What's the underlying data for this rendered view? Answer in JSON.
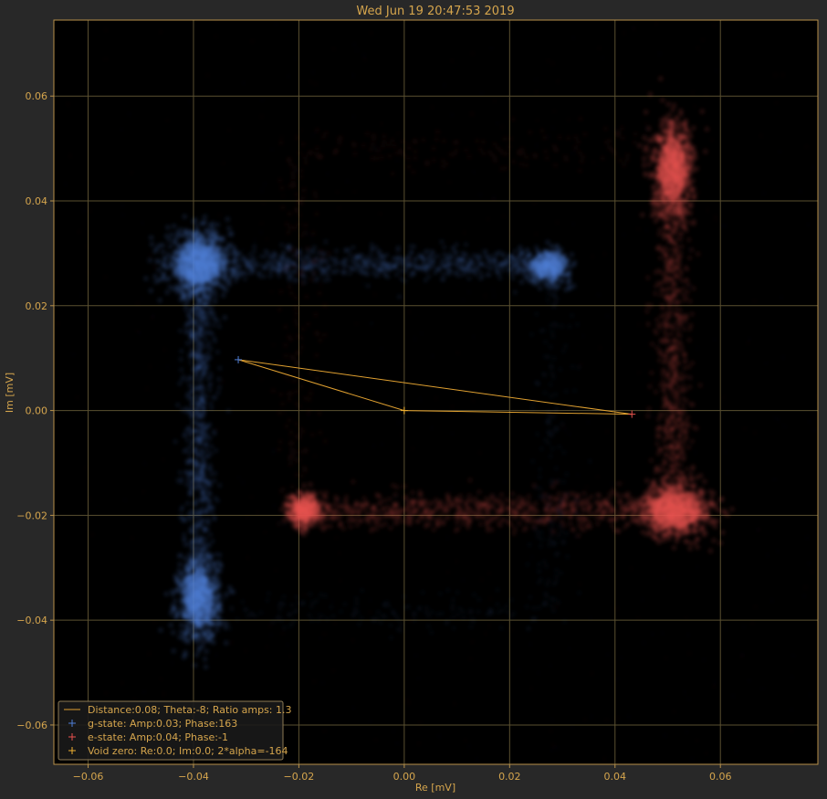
{
  "colors": {
    "figure_bg": "#282828",
    "axes_bg": "#000000",
    "frame": "#b8914a",
    "text": "#d5a54d",
    "grid": "#5a5030",
    "g_state": "#4f7fd8",
    "e_state": "#e8524f",
    "line": "#e0a030",
    "void_zero": "#f0b030"
  },
  "chart_data": {
    "type": "scatter",
    "title": "Wed Jun 19 20:47:53 2019",
    "xlabel": "Re [mV]",
    "ylabel": "Im [mV]",
    "xlim": [
      -0.0665,
      0.0785
    ],
    "ylim": [
      -0.0675,
      0.0745
    ],
    "xticks": [
      -0.06,
      -0.04,
      -0.02,
      0.0,
      0.02,
      0.04,
      0.06
    ],
    "xtick_labels": [
      "−0.06",
      "−0.04",
      "−0.02",
      "0.00",
      "0.02",
      "0.04",
      "0.06"
    ],
    "yticks": [
      0.06,
      0.04,
      0.02,
      0.0,
      -0.02,
      -0.04,
      -0.06
    ],
    "ytick_labels": [
      "0.06",
      "0.04",
      "0.02",
      "0.00",
      "−0.02",
      "−0.04",
      "−0.06"
    ],
    "grid": true,
    "legend_position": "lower-left",
    "series": [
      {
        "color": "#4f7fd8",
        "clusters": [
          {
            "center": [
              -0.039,
              0.028
            ],
            "spread": [
              0.003,
              0.003
            ],
            "weight": 1.0
          },
          {
            "center": [
              -0.039,
              -0.036
            ],
            "spread": [
              0.002,
              0.004
            ],
            "weight": 0.8
          },
          {
            "center": [
              0.0275,
              0.0275
            ],
            "spread": [
              0.002,
              0.0015
            ],
            "weight": 0.5
          }
        ],
        "segments": [
          {
            "from": [
              -0.039,
              0.028
            ],
            "to": [
              0.028,
              0.028
            ],
            "width": 0.0015,
            "intensity": 0.45
          },
          {
            "from": [
              -0.039,
              0.028
            ],
            "to": [
              -0.039,
              -0.038
            ],
            "width": 0.0015,
            "intensity": 0.5
          },
          {
            "from": [
              -0.039,
              -0.038
            ],
            "to": [
              0.028,
              -0.038
            ],
            "width": 0.002,
            "intensity": 0.1
          },
          {
            "from": [
              0.028,
              0.028
            ],
            "to": [
              0.028,
              -0.038
            ],
            "width": 0.002,
            "intensity": 0.1
          }
        ]
      },
      {
        "color": "#e8524f",
        "clusters": [
          {
            "center": [
              0.0515,
              -0.019
            ],
            "spread": [
              0.0035,
              0.0025
            ],
            "weight": 1.0
          },
          {
            "center": [
              0.051,
              0.046
            ],
            "spread": [
              0.002,
              0.0045
            ],
            "weight": 0.85
          },
          {
            "center": [
              -0.019,
              -0.019
            ],
            "spread": [
              0.0015,
              0.0015
            ],
            "weight": 0.55
          }
        ],
        "segments": [
          {
            "from": [
              0.051,
              0.05
            ],
            "to": [
              0.051,
              -0.02
            ],
            "width": 0.0017,
            "intensity": 0.5
          },
          {
            "from": [
              -0.02,
              -0.019
            ],
            "to": [
              0.051,
              -0.019
            ],
            "width": 0.0017,
            "intensity": 0.5
          },
          {
            "from": [
              -0.02,
              0.05
            ],
            "to": [
              -0.02,
              -0.02
            ],
            "width": 0.002,
            "intensity": 0.1
          },
          {
            "from": [
              -0.02,
              0.05
            ],
            "to": [
              0.051,
              0.05
            ],
            "width": 0.002,
            "intensity": 0.1
          }
        ]
      }
    ],
    "markers": {
      "g_state": [
        -0.0315,
        0.0097
      ],
      "e_state": [
        0.0432,
        -0.0007
      ],
      "void_zero": [
        0.0,
        0.0
      ]
    },
    "lines": [
      [
        [
          -0.0315,
          0.0097
        ],
        [
          0.0432,
          -0.0007
        ]
      ],
      [
        [
          -0.0315,
          0.0097
        ],
        [
          0.0,
          0.0
        ]
      ],
      [
        [
          0.0,
          0.0
        ],
        [
          0.0432,
          -0.0007
        ]
      ]
    ],
    "legend": [
      {
        "kind": "line",
        "label": "Distance:0.08; Theta:-8; Ratio amps: 1.3"
      },
      {
        "kind": "g",
        "label": "g-state: Amp:0.03; Phase:163"
      },
      {
        "kind": "e",
        "label": "e-state: Amp:0.04; Phase:-1"
      },
      {
        "kind": "v",
        "label": "Void zero: Re:0.0; Im:0.0; 2*alpha=-164"
      }
    ]
  }
}
